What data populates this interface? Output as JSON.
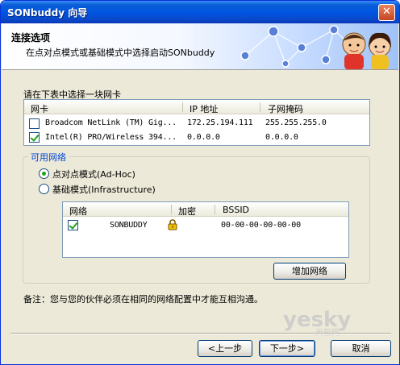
{
  "window": {
    "title": "SONbuddy 向导",
    "close_label": "✕"
  },
  "banner": {
    "title": "连接选项",
    "subtitle": "在点对点模式或基础模式中选择启动SONbuddy"
  },
  "adapter_section": {
    "label": "请在下表中选择一块网卡",
    "columns": [
      "网卡",
      "IP 地址",
      "子网掩码"
    ],
    "rows": [
      {
        "checked": false,
        "name": "Broadcom NetLink (TM) Gig...",
        "ip": "172.25.194.111",
        "mask": "255.255.255.0"
      },
      {
        "checked": true,
        "name": "Intel(R) PRO/Wireless 394...",
        "ip": "0.0.0.0",
        "mask": "0.0.0.0"
      }
    ]
  },
  "network_group": {
    "legend": "可用网络",
    "options": [
      {
        "label": "点对点模式(Ad-Hoc)",
        "selected": true
      },
      {
        "label": "基础模式(Infrastructure)",
        "selected": false
      }
    ],
    "columns": [
      "网络",
      "加密",
      "BSSID"
    ],
    "rows": [
      {
        "checked": true,
        "network": "SONBUDDY",
        "bssid": "00-00-00-00-00-00",
        "encrypted": true
      }
    ],
    "add_button": "增加网络"
  },
  "note": "备注：您与您的伙伴必须在相同的网络配置中才能互相沟通。",
  "footer": {
    "back": "<上一步",
    "next": "下一步>",
    "cancel": "取消"
  },
  "watermark": {
    "text": "yesky",
    "sub": "天极网"
  },
  "colors": {
    "titlebar": "#0053e1",
    "legend": "#0046d5",
    "check": "#21a121"
  }
}
